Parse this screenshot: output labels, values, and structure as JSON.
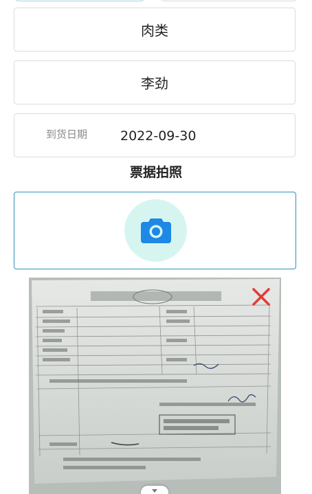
{
  "form": {
    "category_value": "肉类",
    "person_value": "李劲",
    "date_label": "到货日期",
    "date_value": "2022-09-30"
  },
  "photo_section": {
    "title": "票据拍照",
    "camera_icon": "camera-icon",
    "delete_icon": "close-icon",
    "photo_description": "animal quarantine certificate photo"
  },
  "colors": {
    "accent_border": "#2f8fbf",
    "camera_bg": "#d6f5f1",
    "camera_icon": "#1e88e5",
    "delete_x": "#e53935"
  }
}
